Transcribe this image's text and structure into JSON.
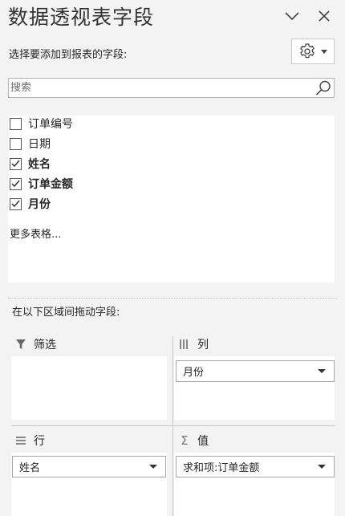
{
  "panel": {
    "title": "数据透视表字段",
    "subtitle": "选择要添加到报表的字段:"
  },
  "search": {
    "placeholder": "搜索",
    "value": ""
  },
  "fields": [
    {
      "label": "订单编号",
      "checked": false,
      "bold": false
    },
    {
      "label": "日期",
      "checked": false,
      "bold": false
    },
    {
      "label": "姓名",
      "checked": true,
      "bold": true
    },
    {
      "label": "订单金额",
      "checked": true,
      "bold": true
    },
    {
      "label": "月份",
      "checked": true,
      "bold": true
    }
  ],
  "more_tables": "更多表格...",
  "drag_label": "在以下区域间拖动字段:",
  "areas": {
    "filters": {
      "label": "筛选",
      "icon": "filter-icon"
    },
    "columns": {
      "label": "列",
      "icon": "columns-icon",
      "item": "月份"
    },
    "rows": {
      "label": "行",
      "icon": "rows-icon",
      "item": "姓名"
    },
    "values": {
      "label": "值",
      "icon": "sigma-icon",
      "item": "求和项:订单金额"
    }
  }
}
